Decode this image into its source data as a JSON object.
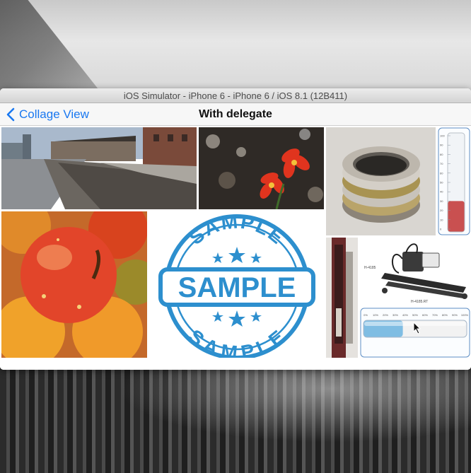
{
  "window": {
    "title": "iOS Simulator - iPhone 6 - iPhone 6 / iOS 8.1 (12B411)"
  },
  "navbar": {
    "back_label": "Collage View",
    "title": "With delegate"
  },
  "collage": {
    "sample_stamp": {
      "top_arc": "SAMPLE",
      "center": "SAMPLE",
      "bottom_arc": "SAMPLE"
    },
    "tank": {
      "ticks": [
        "100",
        "90",
        "80",
        "70",
        "60",
        "50",
        "40",
        "30",
        "20",
        "10",
        "0"
      ],
      "fill_fraction": 0.3
    },
    "machine": {
      "label_a": "H-4185",
      "label_b": "H-4185.RT"
    },
    "progress": {
      "ticks": [
        "0%",
        "10%",
        "20%",
        "30%",
        "40%",
        "50%",
        "60%",
        "70%",
        "80%",
        "90%",
        "100%"
      ],
      "fill_fraction": 0.38
    }
  }
}
